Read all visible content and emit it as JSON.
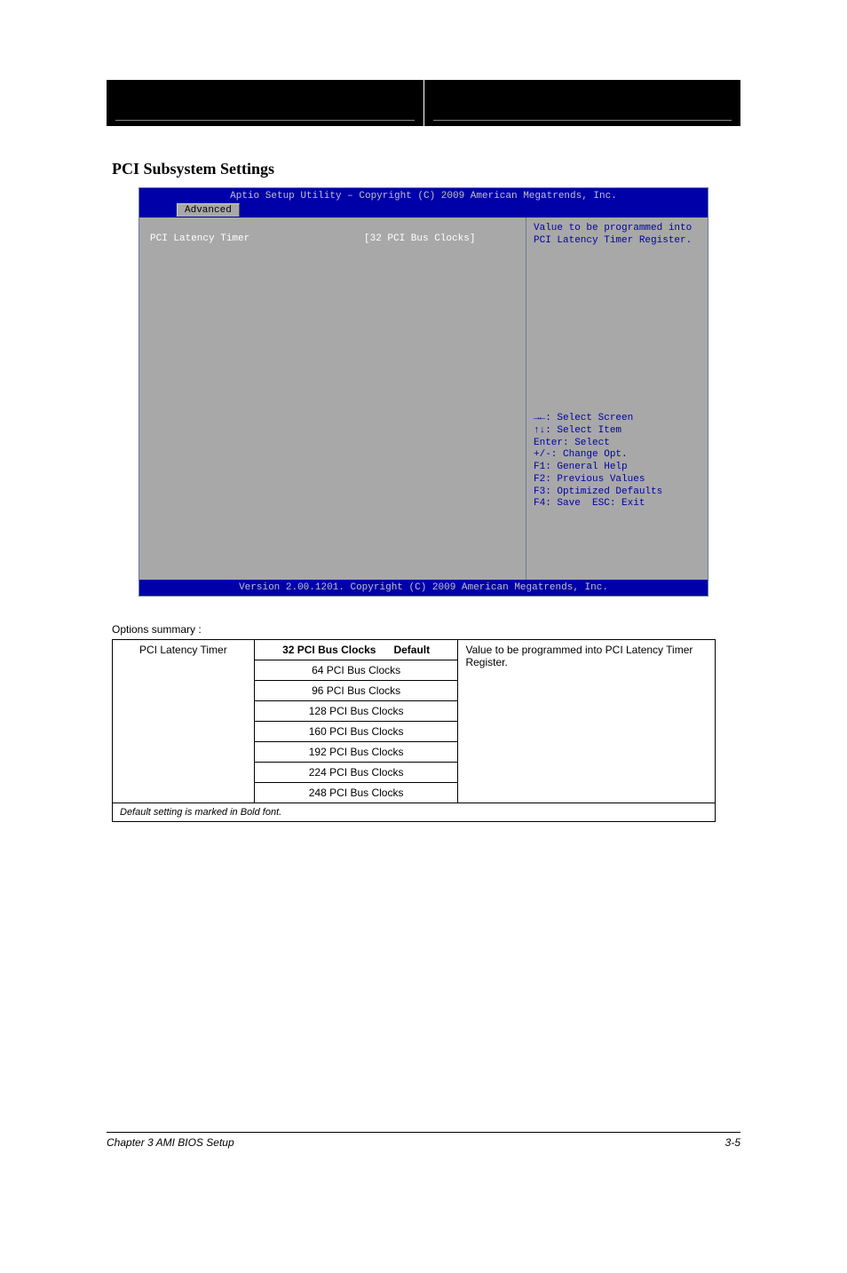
{
  "header": {
    "left_subtitle": "",
    "right_title": ""
  },
  "section_title": "PCI Subsystem Settings",
  "bios": {
    "titlebar": "Aptio Setup Utility – Copyright (C) 2009 American Megatrends, Inc.",
    "tab_label": "Advanced",
    "setting_label": "PCI Latency Timer",
    "setting_value": "[32 PCI Bus Clocks]",
    "help_line1": "Value to be programmed into",
    "help_line2": "PCI Latency Timer Register.",
    "hotkeys": {
      "k1": "→←: Select Screen",
      "k2": "↑↓: Select Item",
      "k3": "Enter: Select",
      "k4": "+/-: Change Opt.",
      "k5": "F1: General Help",
      "k6": "F2: Previous Values",
      "k7": "F3: Optimized Defaults",
      "k8": "F4: Save  ESC: Exit"
    },
    "footer": "Version 2.00.1201. Copyright (C) 2009 American Megatrends, Inc."
  },
  "options": {
    "caption": "Options summary :",
    "item": "PCI Latency Timer",
    "opts": [
      "32 PCI Bus Clocks",
      "64 PCI Bus Clocks",
      "96 PCI Bus Clocks",
      "128 PCI Bus Clocks",
      "160 PCI Bus Clocks",
      "192 PCI Bus Clocks",
      "224 PCI Bus Clocks",
      "248 PCI Bus Clocks"
    ],
    "opt_default": "Default",
    "description": "Value to be programmed into PCI Latency Timer Register.",
    "default_note": "Default setting is marked in Bold font."
  },
  "page_footer": {
    "left": "Chapter 3 AMI BIOS Setup",
    "right": "3-5"
  }
}
